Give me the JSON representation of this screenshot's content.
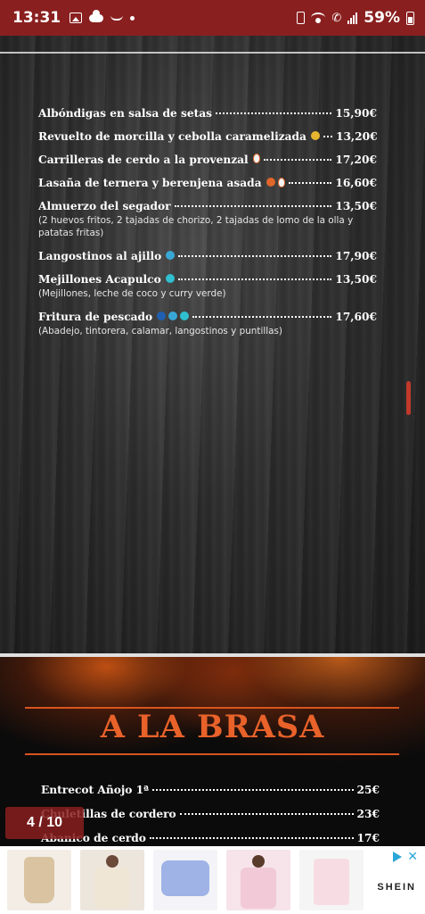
{
  "status_bar": {
    "time": "13:31",
    "battery_percent": "59%"
  },
  "menu": {
    "items": [
      {
        "name": "Albóndigas en salsa de setas",
        "icons": [],
        "price": "15,90€",
        "desc": ""
      },
      {
        "name": "Revuelto de morcilla y cebolla caramelizada",
        "icons": [
          "yellow"
        ],
        "price": "13,20€",
        "desc": ""
      },
      {
        "name": "Carrilleras de cerdo a la provenzal",
        "icons": [
          "flame"
        ],
        "price": "17,20€",
        "desc": ""
      },
      {
        "name": "Lasaña de ternera y berenjena asada",
        "icons": [
          "orange",
          "flame"
        ],
        "price": "16,60€",
        "desc": ""
      },
      {
        "name": "Almuerzo del segador",
        "icons": [],
        "price": "13,50€",
        "desc": "(2 huevos fritos, 2 tajadas de chorizo, 2 tajadas de lomo de la olla y patatas fritas)"
      },
      {
        "name": "Langostinos al ajillo",
        "icons": [
          "blue"
        ],
        "price": "17,90€",
        "desc": ""
      },
      {
        "name": "Mejillones Acapulco",
        "icons": [
          "teal"
        ],
        "price": "13,50€",
        "desc": "(Mejillones, leche de coco y curry verde)"
      },
      {
        "name": "Fritura de pescado",
        "icons": [
          "darkblue",
          "blue",
          "teal"
        ],
        "price": "17,60€",
        "desc": "(Abadejo, tintorera, calamar, langostinos y puntillas)"
      }
    ]
  },
  "brasa": {
    "title": "A LA BRASA",
    "items": [
      {
        "name": "Entrecot Añojo 1ª",
        "price": "25€"
      },
      {
        "name": "Chuletillas de cordero",
        "price": "23€"
      },
      {
        "name": "Abanico de cerdo",
        "price": "17€"
      }
    ]
  },
  "pager": {
    "label": "4 / 10"
  },
  "ad": {
    "brand": "SHEIN",
    "thumbnails": [
      "corset-top",
      "knit-cardigan",
      "lilac-crop-top",
      "floral-blouse",
      "floral-camisole"
    ]
  },
  "colors": {
    "status_bar": "#8a1f1f",
    "brasa_accent": "#e8622a",
    "scroll_indicator": "#c0392b"
  }
}
